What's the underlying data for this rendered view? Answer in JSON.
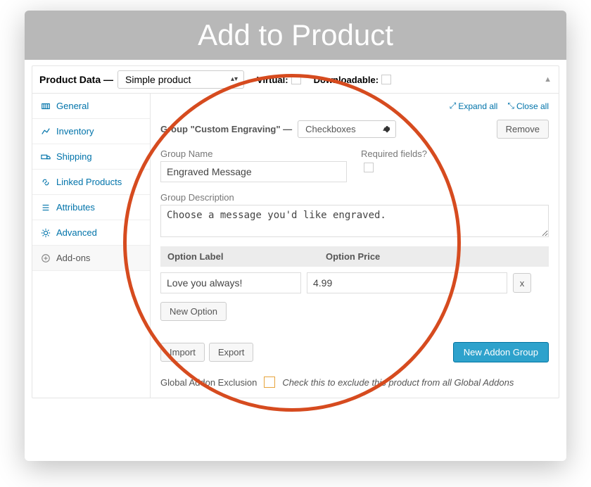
{
  "banner": {
    "title": "Add to Product"
  },
  "panel": {
    "label": "Product Data —",
    "type_select": "Simple product",
    "virtual_label": "Virtual:",
    "downloadable_label": "Downloadable:",
    "collapse_glyph": "▲"
  },
  "sidebar": {
    "items": [
      {
        "label": "General"
      },
      {
        "label": "Inventory"
      },
      {
        "label": "Shipping"
      },
      {
        "label": "Linked Products"
      },
      {
        "label": "Attributes"
      },
      {
        "label": "Advanced"
      },
      {
        "label": "Add-ons"
      }
    ]
  },
  "content": {
    "expand_all": "Expand all",
    "close_all": "Close all",
    "group_title": "Group \"Custom Engraving\" —",
    "group_type": "Checkboxes",
    "remove": "Remove",
    "group_name_label": "Group Name",
    "group_name_value": "Engraved Message",
    "required_label": "Required fields?",
    "group_desc_label": "Group Description",
    "group_desc_value": "Choose a message you'd like engraved.",
    "option_label_head": "Option Label",
    "option_price_head": "Option Price",
    "option_label_value": "Love you always!",
    "option_price_value": "4.99",
    "option_remove": "x",
    "new_option": "New Option",
    "import": "Import",
    "export": "Export",
    "new_group": "New Addon Group",
    "exclusion_label": "Global Addon Exclusion",
    "exclusion_hint": "Check this to exclude this product from all Global Addons"
  }
}
